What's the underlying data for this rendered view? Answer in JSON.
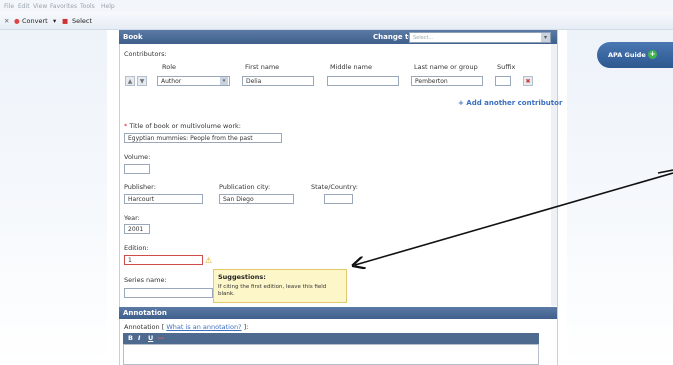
{
  "menu": [
    "File",
    "Edit",
    "View",
    "Favorites",
    "Tools",
    "Help"
  ],
  "toolbar": {
    "convert_label": "Convert",
    "select_label": "Select"
  },
  "book": {
    "header": "Book",
    "change_to_label": "Change to:",
    "change_to_placeholder": "Select..."
  },
  "contributors": {
    "label": "Contributors:",
    "columns": [
      "Role",
      "First name",
      "Middle name",
      "Last name or group",
      "Suffix"
    ],
    "row": {
      "role": "Author",
      "first": "Delia",
      "middle": "",
      "last": "Pemberton",
      "suffix": ""
    },
    "add_label": "+ Add another contributor"
  },
  "title": {
    "label": "Title of book or multivolume work:",
    "value": "Egyptian mummies: People from the past"
  },
  "volume": {
    "label": "Volume:",
    "value": ""
  },
  "publisher": {
    "label": "Publisher:",
    "value": "Harcourt"
  },
  "pub_city": {
    "label": "Publication city:",
    "value": "San Diego"
  },
  "state_country": {
    "label": "State/Country:",
    "value": ""
  },
  "year": {
    "label": "Year:",
    "value": "2001"
  },
  "edition": {
    "label": "Edition:",
    "value": "1"
  },
  "series": {
    "label": "Series name:",
    "value": ""
  },
  "suggestion": {
    "title": "Suggestions:",
    "text": "If citing the first edition, leave this field blank."
  },
  "annotation": {
    "header": "Annotation",
    "label_prefix": "Annotation [",
    "link": "What is an annotation?",
    "label_suffix": "]:",
    "tools": [
      "B",
      "I",
      "U"
    ]
  },
  "apa_guide": {
    "label": "APA Guide"
  }
}
